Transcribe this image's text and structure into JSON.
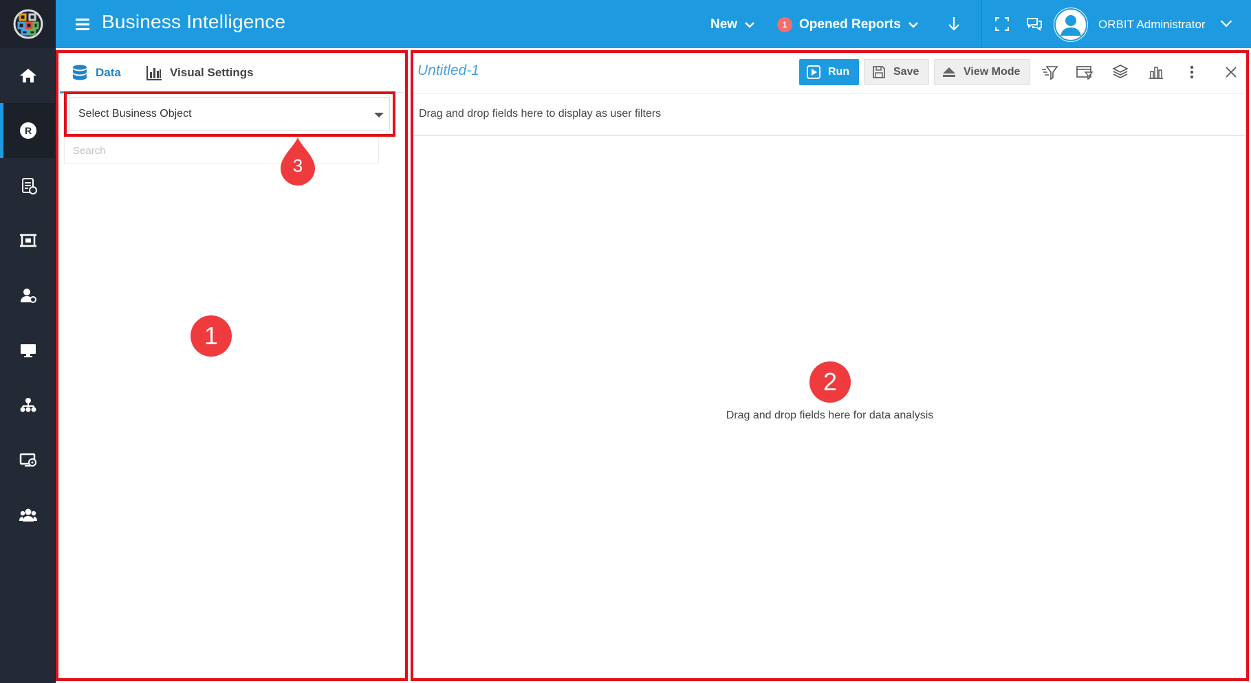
{
  "app": {
    "title": "Business Intelligence"
  },
  "header": {
    "new_label": "New",
    "opened_reports_label": "Opened Reports",
    "opened_reports_count": "1",
    "user_name": "ORBIT Administrator"
  },
  "nav": {
    "items": [
      {
        "icon": "home-icon"
      },
      {
        "icon": "reports-r-icon",
        "active": true
      },
      {
        "icon": "checklist-icon"
      },
      {
        "icon": "dashboard-frame-icon"
      },
      {
        "icon": "user-settings-icon"
      },
      {
        "icon": "monitor-icon"
      },
      {
        "icon": "hierarchy-icon"
      },
      {
        "icon": "screen-settings-icon"
      },
      {
        "icon": "users-group-icon"
      }
    ]
  },
  "left_panel": {
    "tabs": [
      {
        "label": "Data",
        "icon": "database-icon",
        "active": true
      },
      {
        "label": "Visual Settings",
        "icon": "bar-chart-icon"
      }
    ],
    "business_object_select": "Select Business Object",
    "search_placeholder": "Search"
  },
  "report": {
    "title": "Untitled-1",
    "run_label": "Run",
    "save_label": "Save",
    "view_mode_label": "View Mode",
    "filters_hint": "Drag and drop fields here to display as user filters",
    "analysis_hint": "Drag and drop fields here for data analysis"
  },
  "callouts": {
    "one": "1",
    "two": "2",
    "three": "3"
  },
  "colors": {
    "header_bg": "#1e9be0",
    "rail_bg": "#242a35",
    "highlight_red": "#e0101a",
    "marker_red": "#ef3a3e"
  }
}
